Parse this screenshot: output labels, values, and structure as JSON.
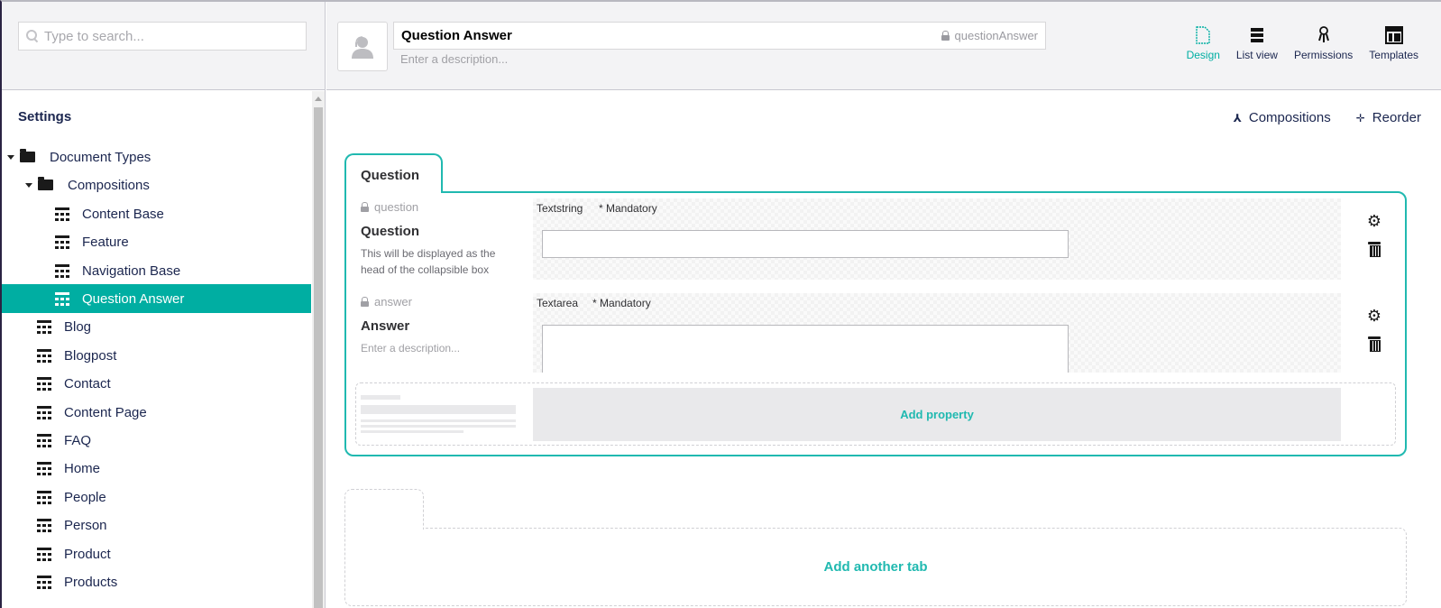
{
  "search": {
    "placeholder": "Type to search..."
  },
  "tree": {
    "title": "Settings",
    "items": [
      {
        "label": "Document Types",
        "type": "folder",
        "level": 0,
        "expanded": true,
        "active": false
      },
      {
        "label": "Compositions",
        "type": "folder",
        "level": 1,
        "expanded": true,
        "active": false
      },
      {
        "label": "Content Base",
        "type": "doctype",
        "level": 2,
        "active": false
      },
      {
        "label": "Feature",
        "type": "doctype",
        "level": 2,
        "active": false
      },
      {
        "label": "Navigation Base",
        "type": "doctype",
        "level": 2,
        "active": false
      },
      {
        "label": "Question Answer",
        "type": "doctype",
        "level": 2,
        "active": true
      },
      {
        "label": "Blog",
        "type": "doctype",
        "level": 1,
        "active": false
      },
      {
        "label": "Blogpost",
        "type": "doctype",
        "level": 1,
        "active": false
      },
      {
        "label": "Contact",
        "type": "doctype",
        "level": 1,
        "active": false
      },
      {
        "label": "Content Page",
        "type": "doctype",
        "level": 1,
        "active": false
      },
      {
        "label": "FAQ",
        "type": "doctype",
        "level": 1,
        "active": false
      },
      {
        "label": "Home",
        "type": "doctype",
        "level": 1,
        "active": false
      },
      {
        "label": "People",
        "type": "doctype",
        "level": 1,
        "active": false
      },
      {
        "label": "Person",
        "type": "doctype",
        "level": 1,
        "active": false
      },
      {
        "label": "Product",
        "type": "doctype",
        "level": 1,
        "active": false
      },
      {
        "label": "Products",
        "type": "doctype",
        "level": 1,
        "active": false
      }
    ]
  },
  "header": {
    "icon": "user-support-icon",
    "name": "Question Answer",
    "alias": "questionAnswer",
    "description_placeholder": "Enter a description..."
  },
  "apps": [
    {
      "label": "Design",
      "icon": "document-icon",
      "active": true
    },
    {
      "label": "List view",
      "icon": "list-icon",
      "active": false
    },
    {
      "label": "Permissions",
      "icon": "keychain-icon",
      "active": false
    },
    {
      "label": "Templates",
      "icon": "layout-icon",
      "active": false
    }
  ],
  "subtools": {
    "compositions": "Compositions",
    "reorder": "Reorder"
  },
  "group": {
    "name": "Question",
    "properties": [
      {
        "alias": "question",
        "label": "Question",
        "description": "This will be displayed as the head of the collapsible box",
        "description_is_placeholder": false,
        "editor": "Textstring",
        "mandatory": "* Mandatory"
      },
      {
        "alias": "answer",
        "label": "Answer",
        "description": "Enter a description...",
        "description_is_placeholder": true,
        "editor": "Textarea",
        "mandatory": "* Mandatory"
      }
    ],
    "add_property": "Add property"
  },
  "add_tab": "Add another tab",
  "colors": {
    "accent": "#00aea2",
    "group_border": "#20b9b0",
    "text": "#1b264f"
  }
}
